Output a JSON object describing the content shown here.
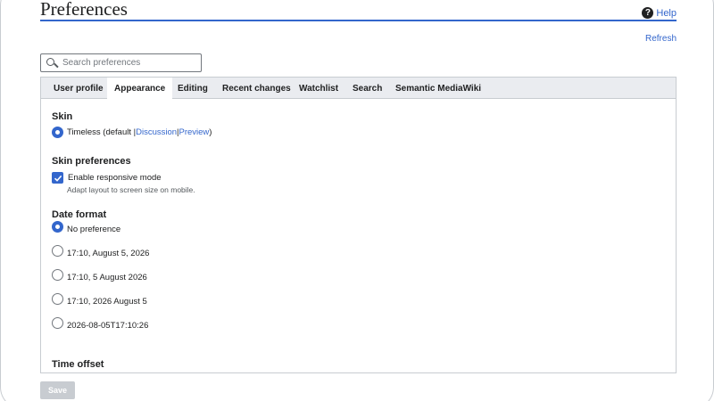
{
  "header": {
    "title": "Preferences",
    "help_label": "Help"
  },
  "refresh_label": "Refresh",
  "search": {
    "placeholder": "Search preferences",
    "value": ""
  },
  "tabs": [
    {
      "label": "User profile"
    },
    {
      "label": "Appearance"
    },
    {
      "label": "Editing"
    },
    {
      "label": "Recent changes"
    },
    {
      "label": "Watchlist"
    },
    {
      "label": "Search"
    },
    {
      "label": "Semantic MediaWiki"
    }
  ],
  "active_tab": "Appearance",
  "skin": {
    "title": "Skin",
    "option": "Timeless (default | ",
    "discussion": "Discussion",
    "sep": " | ",
    "preview": "Preview",
    "close": ")"
  },
  "skin_prefs": {
    "title": "Skin preferences",
    "responsive_label": "Enable responsive mode",
    "responsive_hint": "Adapt layout to screen size on mobile.",
    "responsive_checked": true
  },
  "date_format": {
    "title": "Date format",
    "options": [
      {
        "label": "No preference",
        "checked": true
      },
      {
        "label": "17:10, August 5, 2026",
        "checked": false
      },
      {
        "label": "17:10, 5 August 2026",
        "checked": false
      },
      {
        "label": "17:10, 2026 August 5",
        "checked": false
      },
      {
        "label": "2026-08-05T17:10:26",
        "checked": false
      }
    ]
  },
  "time_offset": {
    "title": "Time offset"
  },
  "save_label": "Save",
  "colors": {
    "accent": "#3366cc",
    "tab_bg": "#eaecf0",
    "border": "#c8ccd1"
  }
}
